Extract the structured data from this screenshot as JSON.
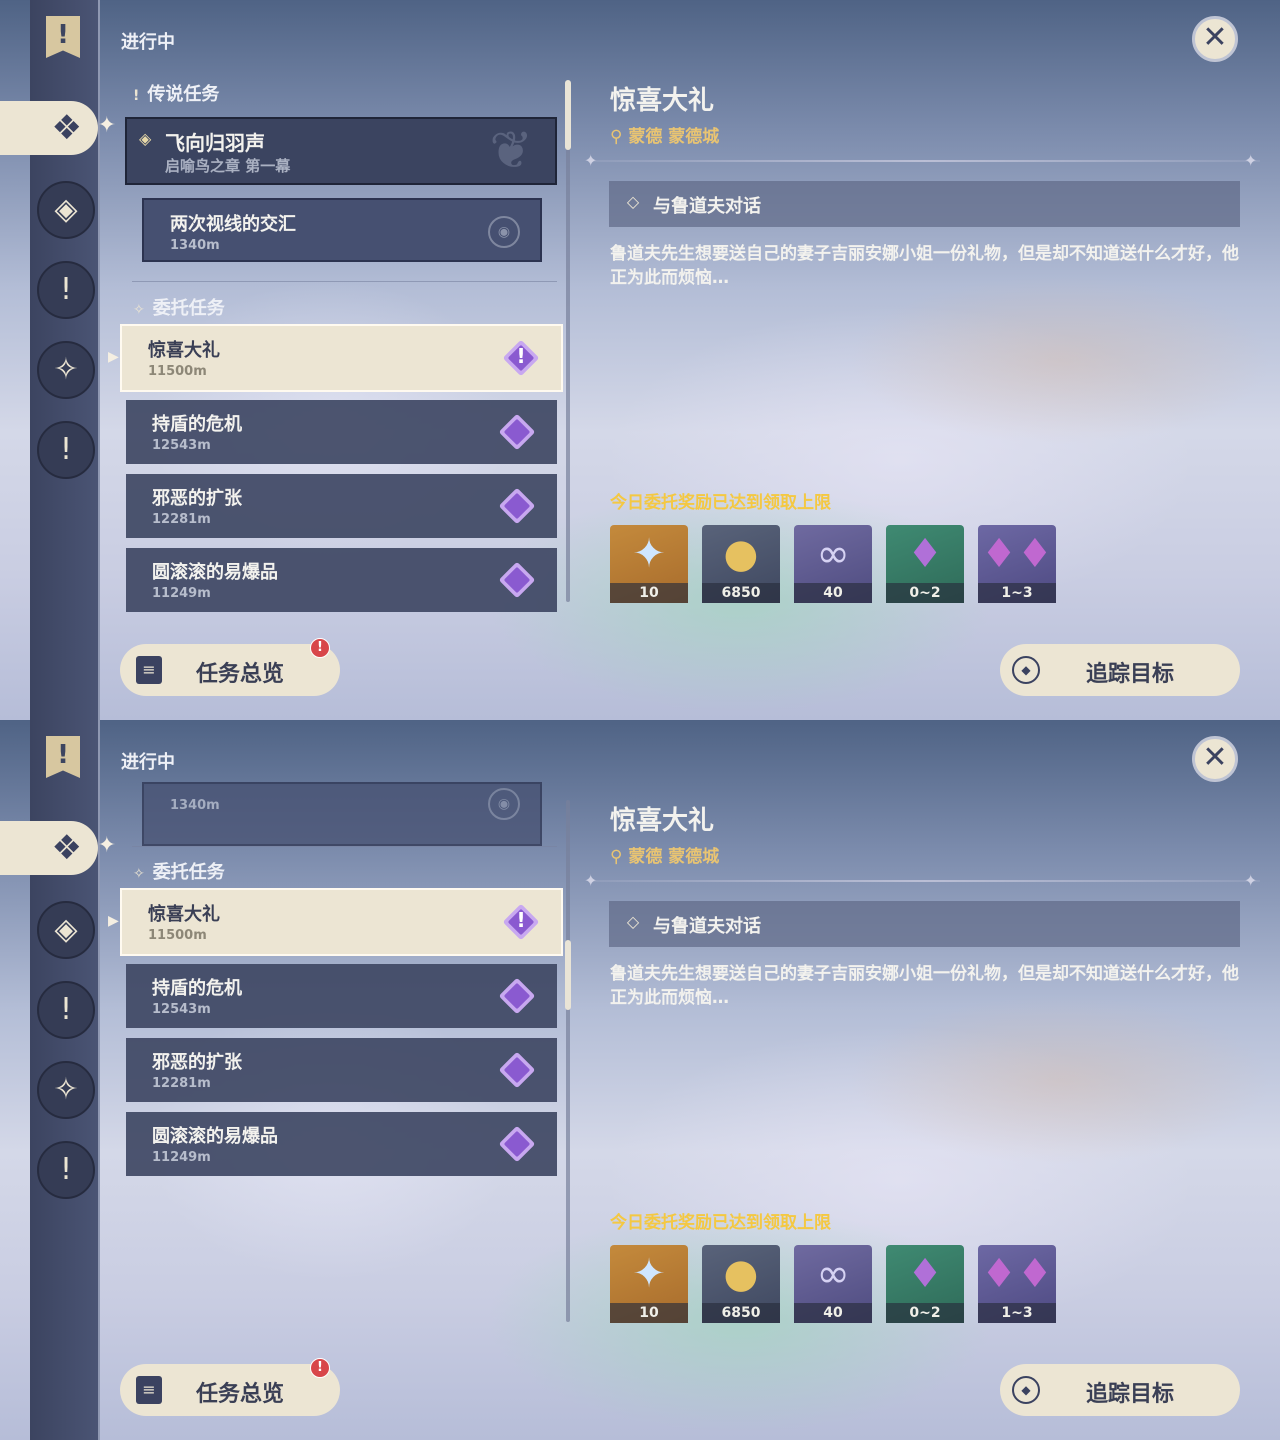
{
  "status_title": "进行中",
  "sections": {
    "legend": "传说任务",
    "commission": "委托任务"
  },
  "legend_quest": {
    "name": "飞向归羽声",
    "chapter": "启喻鸟之章 第一幕"
  },
  "sub_quest": {
    "name": "两次视线的交汇",
    "distance": "1340m"
  },
  "commissions": [
    {
      "name": "惊喜大礼",
      "distance": "11500m"
    },
    {
      "name": "持盾的危机",
      "distance": "12543m"
    },
    {
      "name": "邪恶的扩张",
      "distance": "12281m"
    },
    {
      "name": "圆滚滚的易爆品",
      "distance": "11249m"
    }
  ],
  "icons": {
    "close": "close-icon",
    "banner": "quest-banner-icon",
    "quest_alert": "quest-alert-icon",
    "location_pin": "location-pin-icon"
  },
  "detail": {
    "title": "惊喜大礼",
    "location": "蒙德 蒙德城",
    "objective": "与鲁道夫对话",
    "description": "鲁道夫先生想要送自己的妻子吉丽安娜小姐一份礼物，但是却不知道送什么才好，他正为此而烦恼…",
    "reward_limit": "今日委托奖励已达到领取上限",
    "rewards": [
      {
        "type": "primogem",
        "count": "10"
      },
      {
        "type": "mora",
        "count": "6850"
      },
      {
        "type": "adventure-exp",
        "count": "40"
      },
      {
        "type": "crystal",
        "count": "0~2"
      },
      {
        "type": "crystal-cluster",
        "count": "1~3"
      }
    ]
  },
  "buttons": {
    "overview": "任务总览",
    "overview_badge": "!",
    "track": "追踪目标"
  },
  "colors": {
    "accent_cream": "#ece5d3",
    "panel_dark": "#3b4460",
    "reward_limit_yellow": "#f4c842",
    "location_gold": "#e9c472",
    "commission_purple": "#8a5ad0"
  }
}
